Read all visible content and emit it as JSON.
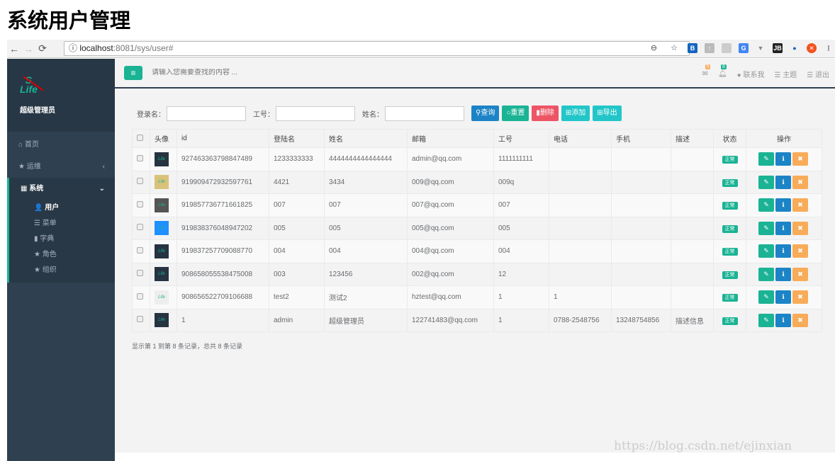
{
  "page_title": "系统用户管理",
  "browser": {
    "host": "localhost",
    "path": ":8081/sys/user#"
  },
  "sidebar": {
    "user_name": "超级管理员",
    "logo": "S Life",
    "items": [
      {
        "label": "首页"
      },
      {
        "label": "运维"
      }
    ],
    "group": {
      "label": "系统",
      "children": [
        {
          "label": "用户"
        },
        {
          "label": "菜单"
        },
        {
          "label": "字典"
        },
        {
          "label": "角色"
        },
        {
          "label": "组织"
        }
      ]
    }
  },
  "topbar": {
    "search_placeholder": "请输入您需要查找的内容 ...",
    "mail_count": "5",
    "notify_count": "8",
    "contact": "联系我",
    "theme": "主题",
    "logout": "退出"
  },
  "filters": {
    "login_label": "登录名：",
    "workno_label": "工号：",
    "name_label": "姓名：",
    "buttons": [
      "查询",
      "重置",
      "删除",
      "添加",
      "导出"
    ]
  },
  "table": {
    "columns": [
      "头像",
      "id",
      "登陆名",
      "姓名",
      "邮箱",
      "工号",
      "电话",
      "手机",
      "描述",
      "状态",
      "操作"
    ],
    "rows": [
      {
        "id": "927463363798847489",
        "login": "1233333333",
        "name": "4444444444444444",
        "email": "admin@qq.com",
        "workno": "1111111111",
        "phone": "",
        "mobile": "",
        "desc": "",
        "status": "正常"
      },
      {
        "id": "919909472932597761",
        "login": "4421",
        "name": "3434",
        "email": "009@qq.com",
        "workno": "009q",
        "phone": "",
        "mobile": "",
        "desc": "",
        "status": "正常"
      },
      {
        "id": "919857736771661825",
        "login": "007",
        "name": "007",
        "email": "007@qq.com",
        "workno": "007",
        "phone": "",
        "mobile": "",
        "desc": "",
        "status": "正常"
      },
      {
        "id": "919838376048947202",
        "login": "005",
        "name": "005",
        "email": "005@qq.com",
        "workno": "005",
        "phone": "",
        "mobile": "",
        "desc": "",
        "status": "正常"
      },
      {
        "id": "919837257709088770",
        "login": "004",
        "name": "004",
        "email": "004@qq.com",
        "workno": "004",
        "phone": "",
        "mobile": "",
        "desc": "",
        "status": "正常"
      },
      {
        "id": "908658055538475008",
        "login": "003",
        "name": "123456",
        "email": "002@qq.com",
        "workno": "12",
        "phone": "",
        "mobile": "",
        "desc": "",
        "status": "正常"
      },
      {
        "id": "908656522709106688",
        "login": "test2",
        "name": "测试2",
        "email": "hztest@qq.com",
        "workno": "1",
        "phone": "1",
        "mobile": "",
        "desc": "",
        "status": "正常"
      },
      {
        "id": "1",
        "login": "admin",
        "name": "超级管理员",
        "email": "122741483@qq.com",
        "workno": "1",
        "phone": "0788-2548756",
        "mobile": "13248754856",
        "desc": "描述信息",
        "status": "正常"
      }
    ]
  },
  "pagination_info": "显示第 1 到第 8 条记录，总共 8 条记录",
  "watermark": "https://blog.csdn.net/ejinxian",
  "colors": {
    "primary": "#1ab394",
    "blue": "#1c84c6",
    "red": "#ed5565",
    "cyan": "#23c6c8",
    "orange": "#f8ac59",
    "sidebar": "#2f4050"
  }
}
